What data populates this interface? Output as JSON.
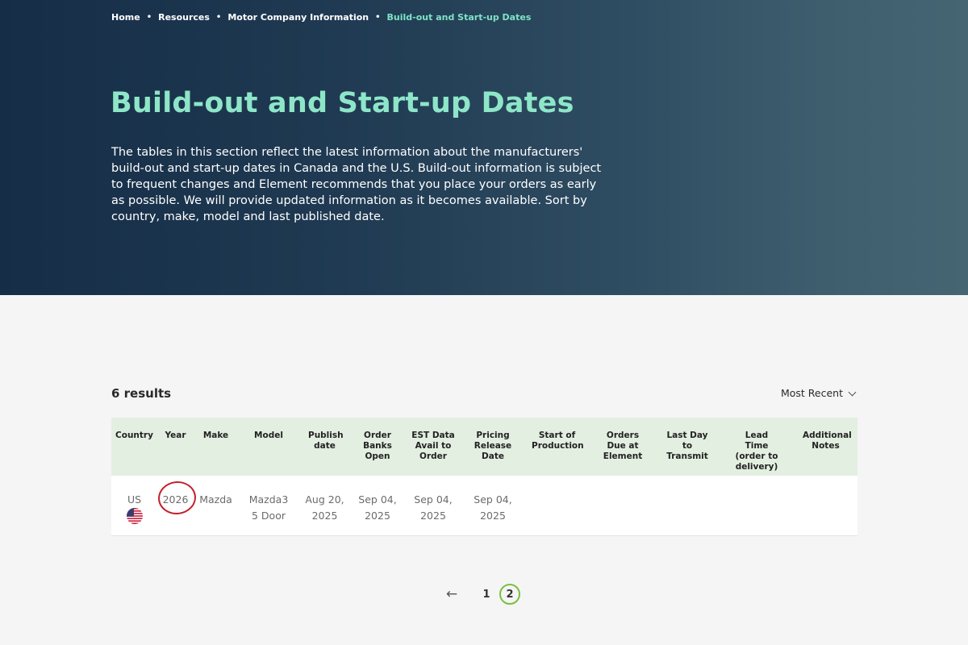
{
  "breadcrumb": {
    "items": [
      "Home",
      "Resources",
      "Motor Company Information"
    ],
    "current": "Build-out and Start-up Dates",
    "separator": "•"
  },
  "hero": {
    "title": "Build-out and Start-up Dates",
    "description": "The tables in this section reflect the latest information about the manufacturers' build-out and start-up dates in Canada and the U.S. Build-out information is subject to frequent changes and Element recommends that you place your orders as early as possible. We will provide updated information as it becomes available. Sort by country, make, model and last published date."
  },
  "results": {
    "count_label": "6 results",
    "sort_label": "Most Recent"
  },
  "table": {
    "headers": [
      "Country",
      "Year",
      "Make",
      "Model",
      "Publish date",
      "Order Banks Open",
      "EST Data Avail to Order",
      "Pricing Release Date",
      "Start of Production",
      "Orders Due at Element",
      "Last Day to Transmit",
      "Lead Time (order to delivery)",
      "Additional Notes"
    ],
    "rows": [
      {
        "country": "US",
        "flag_icon": "us-flag-icon",
        "year": "2026",
        "make": "Mazda",
        "model": "Mazda3 5 Door",
        "publish_date": "Aug 20, 2025",
        "order_banks_open": "Sep 04, 2025",
        "est_data_avail": "Sep 04, 2025",
        "pricing_release": "Sep 04, 2025",
        "start_of_production": "",
        "orders_due": "",
        "last_day_transmit": "",
        "lead_time": "",
        "notes": ""
      }
    ]
  },
  "pagination": {
    "prev_icon": "arrow-left-icon",
    "prev_glyph": "←",
    "pages": [
      "1",
      "2"
    ],
    "active_page": "2"
  },
  "colors": {
    "title_accent": "#8ee6c8",
    "breadcrumb_current": "#7fe3c6",
    "table_header_bg": "#e3efe1",
    "active_page_ring": "#7cbf3f",
    "annotation_circle": "#c2222c"
  }
}
